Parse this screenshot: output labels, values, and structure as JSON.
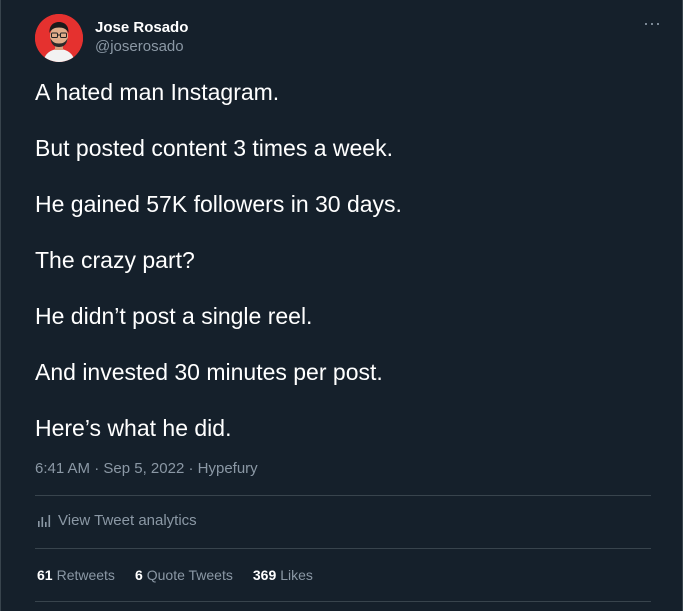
{
  "author": {
    "name": "Jose Rosado",
    "handle": "@joserosado"
  },
  "tweet": {
    "paragraphs": [
      "A hated man Instagram.",
      "But posted content 3 times a week.",
      "He gained 57K followers in 30 days.",
      "The crazy part?",
      "He didn’t post a single reel.",
      "And invested 30 minutes per post.",
      "Here’s what he did."
    ],
    "time": "6:41 AM",
    "separator": "·",
    "date": "Sep 5, 2022",
    "source": "Hypefury"
  },
  "analytics": {
    "label": "View Tweet analytics"
  },
  "stats": {
    "retweets_count": "61",
    "retweets_label": "Retweets",
    "quotes_count": "6",
    "quotes_label": "Quote Tweets",
    "likes_count": "369",
    "likes_label": "Likes"
  },
  "more_button": {
    "symbol": "···"
  },
  "colors": {
    "background": "#15202b",
    "text": "#ffffff",
    "secondary": "#8b98a5",
    "border": "#38444d"
  }
}
